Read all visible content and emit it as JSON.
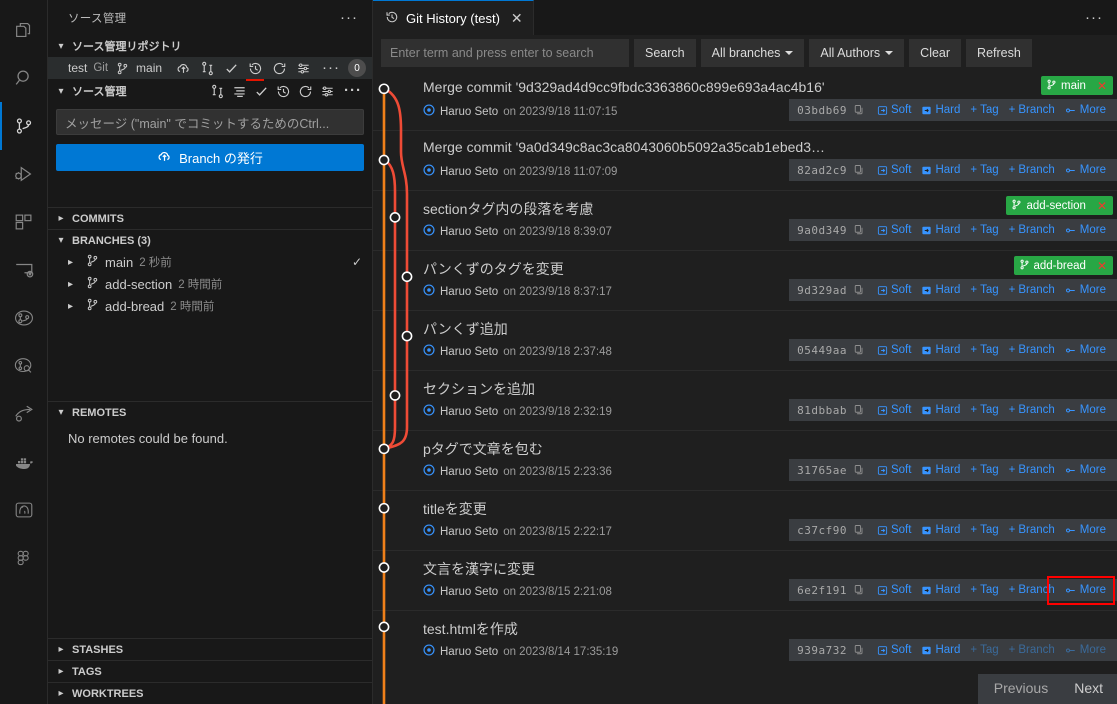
{
  "activitybar": {
    "items": [
      {
        "icon": "files-explorer-icon",
        "name": "activitybar-explorer",
        "active": false
      },
      {
        "icon": "search-icon",
        "name": "activitybar-search",
        "active": false
      },
      {
        "icon": "source-control-icon",
        "name": "activitybar-source-control",
        "active": true
      },
      {
        "icon": "run-and-debug-icon",
        "name": "activitybar-run-debug",
        "active": false
      },
      {
        "icon": "extensions-icon",
        "name": "activitybar-extensions",
        "active": false
      },
      {
        "icon": "remote-explorer-icon",
        "name": "activitybar-remote-explorer",
        "active": false
      },
      {
        "icon": "git-graph-icon",
        "name": "activitybar-git-graph",
        "active": false
      },
      {
        "icon": "git-lens-icon",
        "name": "activitybar-gitlens",
        "active": false
      },
      {
        "icon": "share-icon",
        "name": "activitybar-live-share",
        "active": false
      },
      {
        "icon": "docker-icon",
        "name": "activitybar-docker",
        "active": false
      },
      {
        "icon": "postgres-elephant-icon",
        "name": "activitybar-postgres",
        "active": false
      },
      {
        "icon": "figma-icon",
        "name": "activitybar-figma",
        "active": false
      }
    ]
  },
  "sidebar": {
    "title": "ソース管理",
    "repositories_section": {
      "label": "ソース管理リポジトリ",
      "expanded": true
    },
    "repo": {
      "name": "test",
      "provider": "Git",
      "branch": "main",
      "change_count": "0",
      "icons": [
        "branch-icon",
        "cloud-upload-icon",
        "compare-changes-icon",
        "commit-check-icon",
        "history-icon",
        "refresh-icon",
        "view-changes-icon",
        "more-icon"
      ]
    },
    "scm_section": {
      "label": "ソース管理",
      "icons": [
        "compare-changes-icon",
        "view-as-list-icon",
        "commit-check-icon",
        "history-icon",
        "refresh-icon",
        "view-changes-icon",
        "more-icon"
      ]
    },
    "commit_input_placeholder": "メッセージ (\"main\" でコミットするためのCtrl...",
    "publish_button": "Branch の発行",
    "sections": [
      {
        "label": "COMMITS",
        "expanded": false
      },
      {
        "label": "BRANCHES (3)",
        "expanded": true
      },
      {
        "label": "REMOTES",
        "expanded": true
      },
      {
        "label": "STASHES",
        "expanded": false
      },
      {
        "label": "TAGS",
        "expanded": false
      },
      {
        "label": "WORKTREES",
        "expanded": false
      }
    ],
    "branches": [
      {
        "name": "main",
        "meta": "2 秒前",
        "current": true
      },
      {
        "name": "add-section",
        "meta": "2 時間前",
        "current": false
      },
      {
        "name": "add-bread",
        "meta": "2 時間前",
        "current": false
      }
    ],
    "remotes_message": "No remotes could be found."
  },
  "editor": {
    "tab": {
      "label": "Git History (test)",
      "icon": "history-icon",
      "close": "✕"
    },
    "more_actions": "…",
    "toolbar": {
      "search_placeholder": "Enter term and press enter to search",
      "search_value": "",
      "search_button": "Search",
      "branches_filter": "All branches",
      "authors_filter": "All Authors",
      "clear_button": "Clear",
      "refresh_button": "Refresh"
    },
    "actions_labels": {
      "soft": "Soft",
      "hard": "Hard",
      "tag": "Tag",
      "branch": "Branch",
      "more": "More"
    },
    "pager": {
      "previous": "Previous",
      "next": "Next"
    },
    "commits": [
      {
        "subject": "Merge commit '9d329ad4d9cc9fbdc3363860c899e693a4ac4b16'",
        "author": "Haruo Seto",
        "date": "on 2023/9/18 11:07:15",
        "hash": "03bdb69",
        "refs": [
          {
            "name": "main",
            "color": "#28a745"
          }
        ],
        "dimmed": false
      },
      {
        "subject": "Merge commit '9a0d349c8ac3ca8043060b5092a35cab1ebed3…",
        "author": "Haruo Seto",
        "date": "on 2023/9/18 11:07:09",
        "hash": "82ad2c9",
        "refs": [],
        "dimmed": false
      },
      {
        "subject": "sectionタグ内の段落を考慮",
        "author": "Haruo Seto",
        "date": "on 2023/9/18 8:39:07",
        "hash": "9a0d349",
        "refs": [
          {
            "name": "add-section",
            "color": "#28a745"
          }
        ],
        "dimmed": false
      },
      {
        "subject": "パンくずのタグを変更",
        "author": "Haruo Seto",
        "date": "on 2023/9/18 8:37:17",
        "hash": "9d329ad",
        "refs": [
          {
            "name": "add-bread",
            "color": "#28a745"
          }
        ],
        "dimmed": false
      },
      {
        "subject": "パンくず追加",
        "author": "Haruo Seto",
        "date": "on 2023/9/18 2:37:48",
        "hash": "05449aa",
        "refs": [],
        "dimmed": false
      },
      {
        "subject": "セクションを追加",
        "author": "Haruo Seto",
        "date": "on 2023/9/18 2:32:19",
        "hash": "81dbbab",
        "refs": [],
        "dimmed": false
      },
      {
        "subject": "pタグで文章を包む",
        "author": "Haruo Seto",
        "date": "on 2023/8/15 2:23:36",
        "hash": "31765ae",
        "refs": [],
        "dimmed": false
      },
      {
        "subject": "titleを変更",
        "author": "Haruo Seto",
        "date": "on 2023/8/15 2:22:17",
        "hash": "c37cf90",
        "refs": [],
        "dimmed": false
      },
      {
        "subject": "文言を漢字に変更",
        "author": "Haruo Seto",
        "date": "on 2023/8/15 2:21:08",
        "hash": "6e2f191",
        "refs": [],
        "dimmed": false,
        "highlight_more": true
      },
      {
        "subject": "test.htmlを作成",
        "author": "Haruo Seto",
        "date": "on 2023/8/14 17:35:19",
        "hash": "939a732",
        "refs": [],
        "dimmed": true
      }
    ]
  },
  "colors": {
    "accent": "#0078d4",
    "graph_orange": "#f0801a",
    "graph_red": "#ef4b36",
    "badge_green": "#28a745",
    "link_blue": "#3794ff",
    "highlight_red": "#ff0000",
    "editor_bg": "#1f1f1f",
    "sidebar_bg": "#181818"
  }
}
